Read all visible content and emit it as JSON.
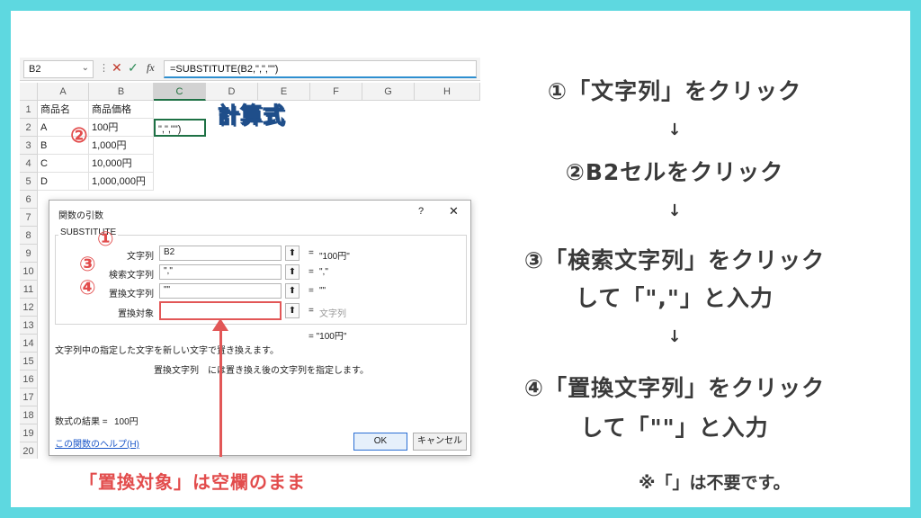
{
  "formula_bar": {
    "name_box": "B2",
    "formula": "=SUBSTITUTE(B2,\",\",\"\")"
  },
  "sheet": {
    "columns": [
      "A",
      "B",
      "C",
      "D",
      "E",
      "F",
      "G",
      "H"
    ],
    "rows": [
      "1",
      "2",
      "3",
      "4",
      "5",
      "6",
      "7",
      "8",
      "9",
      "10",
      "11",
      "12",
      "13",
      "14",
      "15",
      "16",
      "17",
      "18",
      "19",
      "20"
    ],
    "headers": [
      "商品名",
      "商品価格"
    ],
    "data": [
      [
        "A",
        "100円"
      ],
      [
        "B",
        "1,000円"
      ],
      [
        "C",
        "10,000円"
      ],
      [
        "D",
        "1,000,000円"
      ]
    ],
    "active_cell": "\",\",\"\")",
    "keisan_label": "計算式"
  },
  "dialog": {
    "title": "関数の引数",
    "help": "?",
    "close": "✕",
    "function": "SUBSTITUTE",
    "args": [
      {
        "label": "文字列",
        "value": "B2",
        "result": "\"100円\""
      },
      {
        "label": "検索文字列",
        "value": "\",\"",
        "result": "\",\""
      },
      {
        "label": "置換文字列",
        "value": "\"\"",
        "result": "\"\""
      },
      {
        "label": "置換対象",
        "value": "",
        "result": "文字列"
      }
    ],
    "overall_result": "= \"100円\"",
    "description": "文字列中の指定した文字を新しい文字で置き換えます。",
    "arg_help_name": "置換文字列",
    "arg_help_text": "には置き換え後の文字列を指定します。",
    "result_label": "数式の結果 =",
    "result_value": "100円",
    "help_link": "この関数のヘルプ(H)",
    "ok": "OK",
    "cancel": "キャンセル"
  },
  "markers": {
    "m1": "①",
    "m2": "②",
    "m3": "③",
    "m4": "④"
  },
  "annotation": "「置換対象」は空欄のまま",
  "steps": {
    "s1": "①「文字列」をクリック",
    "s2": "②B2セルをクリック",
    "s3a": "③「検索文字列」をクリック",
    "s3b": "して「\",\"」と入力",
    "s4a": "④「置換文字列」をクリック",
    "s4b": "して「\"\"」と入力",
    "arrow": "↓",
    "footnote": "※「」は不要です。"
  },
  "colors": {
    "frame": "#5ed8e0",
    "accent_red": "#e24c4c",
    "excel_green": "#1e7145",
    "keisan_blue": "#3b8ee0"
  }
}
